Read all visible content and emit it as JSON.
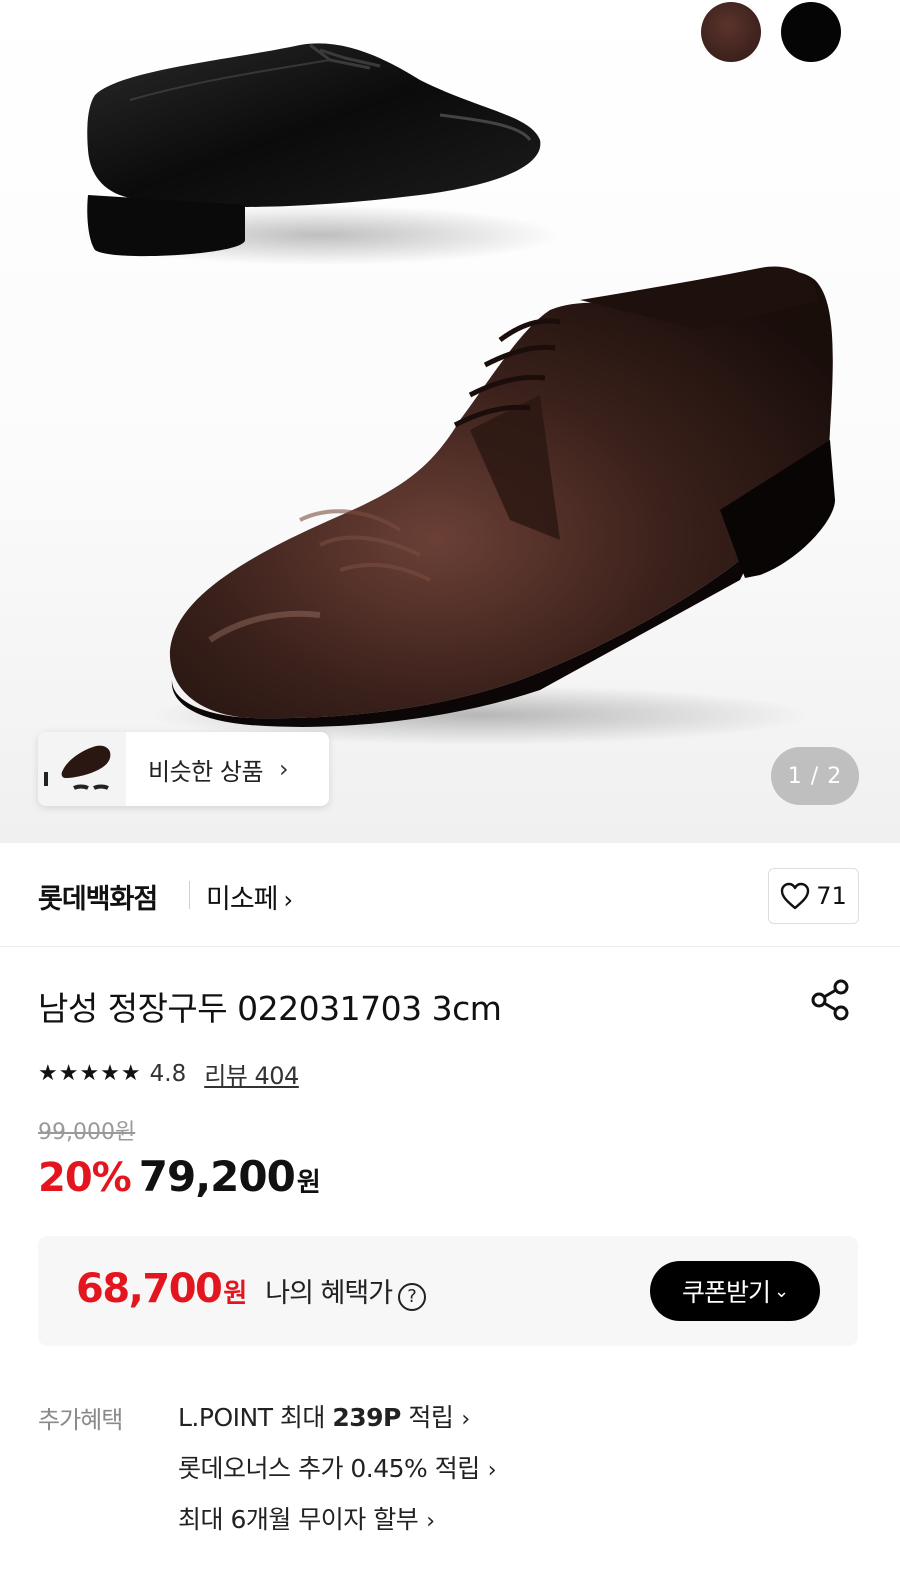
{
  "colors": {
    "sale_red": "#e3161f",
    "swatch_brown": "#3d211c",
    "swatch_black": "#050505"
  },
  "gallery": {
    "similar_products_label": "비슷한 상품",
    "chevron": "›",
    "page_indicator": "1 / 2",
    "swatches": [
      "brown",
      "black"
    ]
  },
  "brand_row": {
    "brand": "롯데백화점",
    "sub_brand": "미소페",
    "sub_brand_chevron": "›",
    "like_count": "71"
  },
  "product": {
    "title": "남성 정장구두 022031703 3cm",
    "stars": "★★★★★",
    "rating": "4.8",
    "review_link": "리뷰 404"
  },
  "pricing": {
    "original_price": "99,000원",
    "discount": "20%",
    "price": "79,200",
    "currency": "원",
    "benefit_price": "68,700",
    "benefit_currency": "원",
    "benefit_label": "나의 혜택가",
    "help_icon": "?",
    "coupon_button": "쿠폰받기",
    "coupon_chevron": "⌄"
  },
  "extra_benefits": {
    "label": "추가혜택",
    "items": [
      {
        "pre": "L.POINT 최대 ",
        "bold": "239P",
        "post": " 적립",
        "chevron": "›"
      },
      {
        "pre": "롯데오너스 추가 0.45% 적립",
        "bold": "",
        "post": "",
        "chevron": "›"
      },
      {
        "pre": "최대 6개월 무이자 할부",
        "bold": "",
        "post": "",
        "chevron": "›"
      }
    ]
  }
}
